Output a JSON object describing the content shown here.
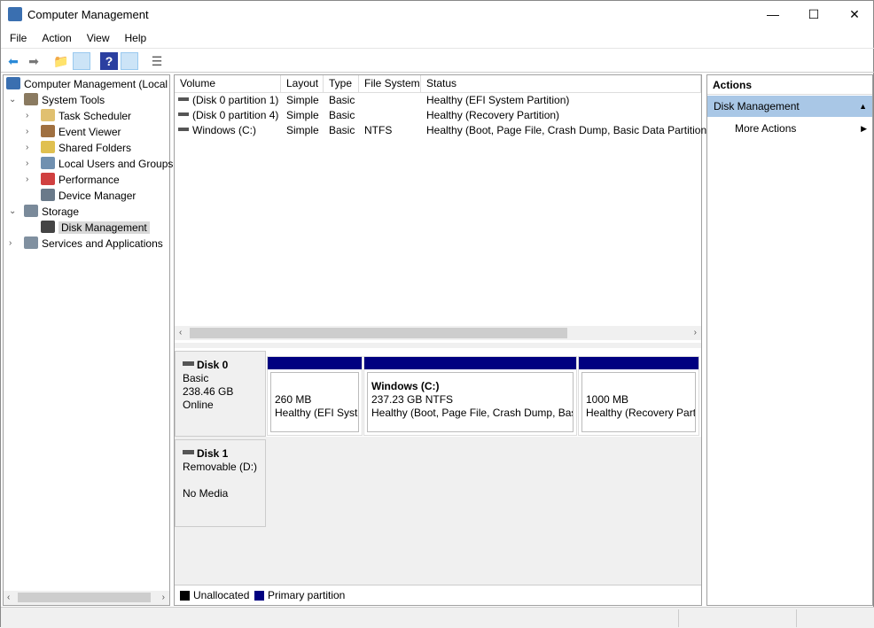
{
  "window": {
    "title": "Computer Management",
    "minimize": "—",
    "maximize": "☐",
    "close": "✕"
  },
  "menu": [
    "File",
    "Action",
    "View",
    "Help"
  ],
  "tree": {
    "root": "Computer Management (Local",
    "items": [
      {
        "label": "System Tools",
        "level": 1,
        "expanded": true
      },
      {
        "label": "Task Scheduler",
        "level": 2
      },
      {
        "label": "Event Viewer",
        "level": 2
      },
      {
        "label": "Shared Folders",
        "level": 2
      },
      {
        "label": "Local Users and Groups",
        "level": 2
      },
      {
        "label": "Performance",
        "level": 2
      },
      {
        "label": "Device Manager",
        "level": 2
      },
      {
        "label": "Storage",
        "level": 1,
        "expanded": true
      },
      {
        "label": "Disk Management",
        "level": 2,
        "selected": true
      },
      {
        "label": "Services and Applications",
        "level": 1
      }
    ]
  },
  "volumes": {
    "columns": [
      "Volume",
      "Layout",
      "Type",
      "File System",
      "Status"
    ],
    "rows": [
      [
        "(Disk 0 partition 1)",
        "Simple",
        "Basic",
        "",
        "Healthy (EFI System Partition)"
      ],
      [
        "(Disk 0 partition 4)",
        "Simple",
        "Basic",
        "",
        "Healthy (Recovery Partition)"
      ],
      [
        "Windows (C:)",
        "Simple",
        "Basic",
        "NTFS",
        "Healthy (Boot, Page File, Crash Dump, Basic Data Partition)"
      ]
    ]
  },
  "disks": [
    {
      "name": "Disk 0",
      "type": "Basic",
      "size": "238.46 GB",
      "state": "Online",
      "partitions": [
        {
          "title": "",
          "size": "260 MB",
          "status": "Healthy (EFI Syste"
        },
        {
          "title": "Windows  (C:)",
          "size": "237.23 GB NTFS",
          "status": "Healthy (Boot, Page File, Crash Dump, Basi"
        },
        {
          "title": "",
          "size": "1000 MB",
          "status": "Healthy (Recovery Part"
        }
      ]
    },
    {
      "name": "Disk 1",
      "type": "Removable (D:)",
      "size": "",
      "state": "No Media"
    }
  ],
  "legend": [
    {
      "label": "Unallocated",
      "color": "#000000"
    },
    {
      "label": "Primary partition",
      "color": "#000080"
    }
  ],
  "actions": {
    "title": "Actions",
    "section": "Disk Management",
    "more": "More Actions"
  }
}
